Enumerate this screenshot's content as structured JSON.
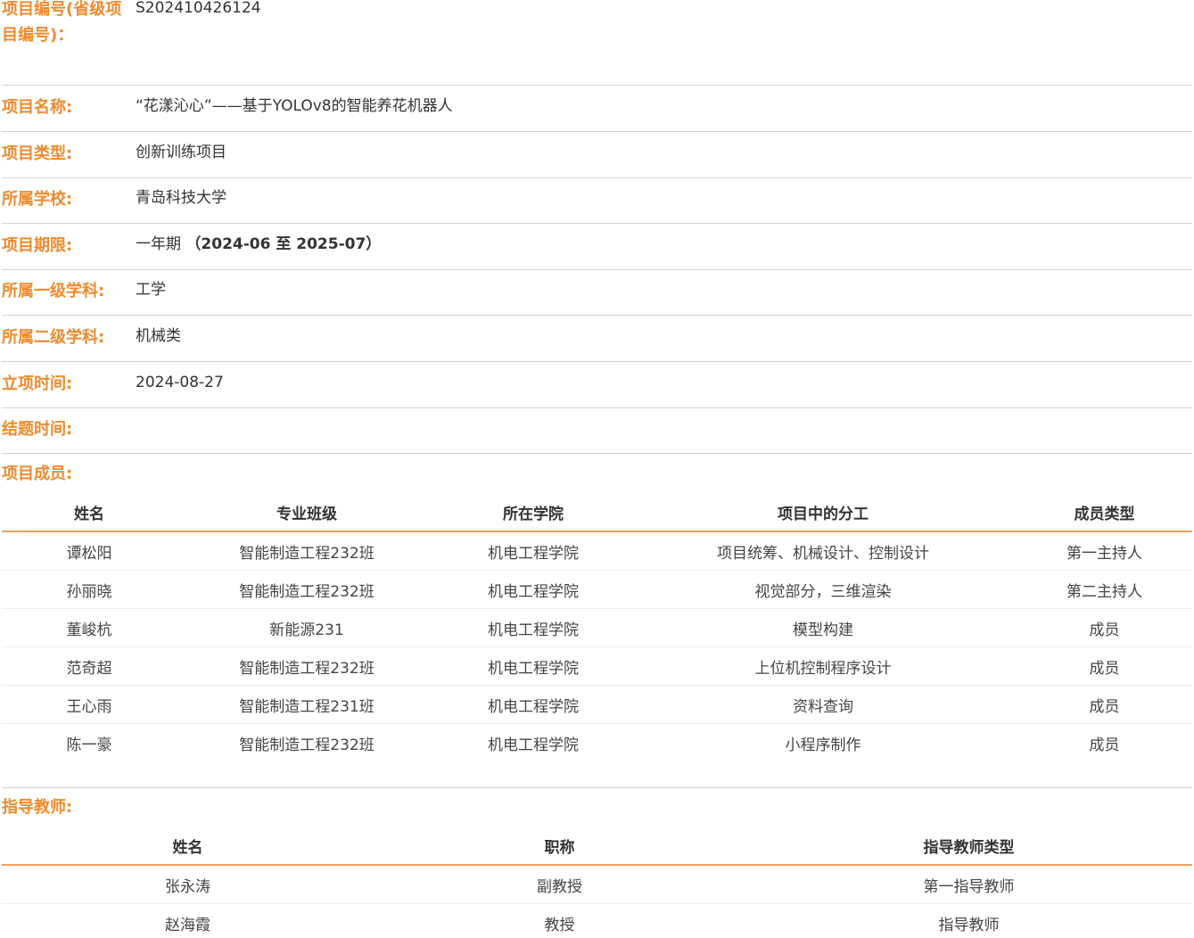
{
  "project": {
    "number": {
      "label": "项目编号(省级项目编号)：",
      "value": "S202410426124"
    },
    "name": {
      "label": "项目名称:",
      "value": "“花漾沁心”——基于YOLOv8的智能养花机器人"
    },
    "type": {
      "label": "项目类型:",
      "value": "创新训练项目"
    },
    "school": {
      "label": "所属学校:",
      "value": "青岛科技大学"
    },
    "period": {
      "label": "项目期限:",
      "value_main": "一年期",
      "value_range": "（2024-06 至 2025-07）"
    },
    "discipline_1": {
      "label": "所属一级学科:",
      "value": "工学"
    },
    "discipline_2": {
      "label": "所属二级学科:",
      "value": "机械类"
    },
    "start_time": {
      "label": "立项时间:",
      "value": "2024-08-27"
    },
    "end_time": {
      "label": "结题时间:",
      "value": ""
    }
  },
  "members": {
    "label": "项目成员:",
    "headers": [
      "姓名",
      "专业班级",
      "所在学院",
      "项目中的分工",
      "成员类型"
    ],
    "rows": [
      [
        "谭松阳",
        "智能制造工程232班",
        "机电工程学院",
        "项目统筹、机械设计、控制设计",
        "第一主持人"
      ],
      [
        "孙丽晓",
        "智能制造工程232班",
        "机电工程学院",
        "视觉部分，三维渲染",
        "第二主持人"
      ],
      [
        "董峻杭",
        "新能源231",
        "机电工程学院",
        "模型构建",
        "成员"
      ],
      [
        "范奇超",
        "智能制造工程232班",
        "机电工程学院",
        "上位机控制程序设计",
        "成员"
      ],
      [
        "王心雨",
        "智能制造工程231班",
        "机电工程学院",
        "资料查询",
        "成员"
      ],
      [
        "陈一豪",
        "智能制造工程232班",
        "机电工程学院",
        "小程序制作",
        "成员"
      ]
    ]
  },
  "advisors": {
    "label": "指导教师:",
    "headers": [
      "姓名",
      "职称",
      "指导教师类型"
    ],
    "rows": [
      [
        "张永涛",
        "副教授",
        "第一指导教师"
      ],
      [
        "赵海霞",
        "教授",
        "指导教师"
      ]
    ]
  },
  "colors": {
    "label_accent": "#f08a2c",
    "header_rule": "#f0a25a"
  }
}
